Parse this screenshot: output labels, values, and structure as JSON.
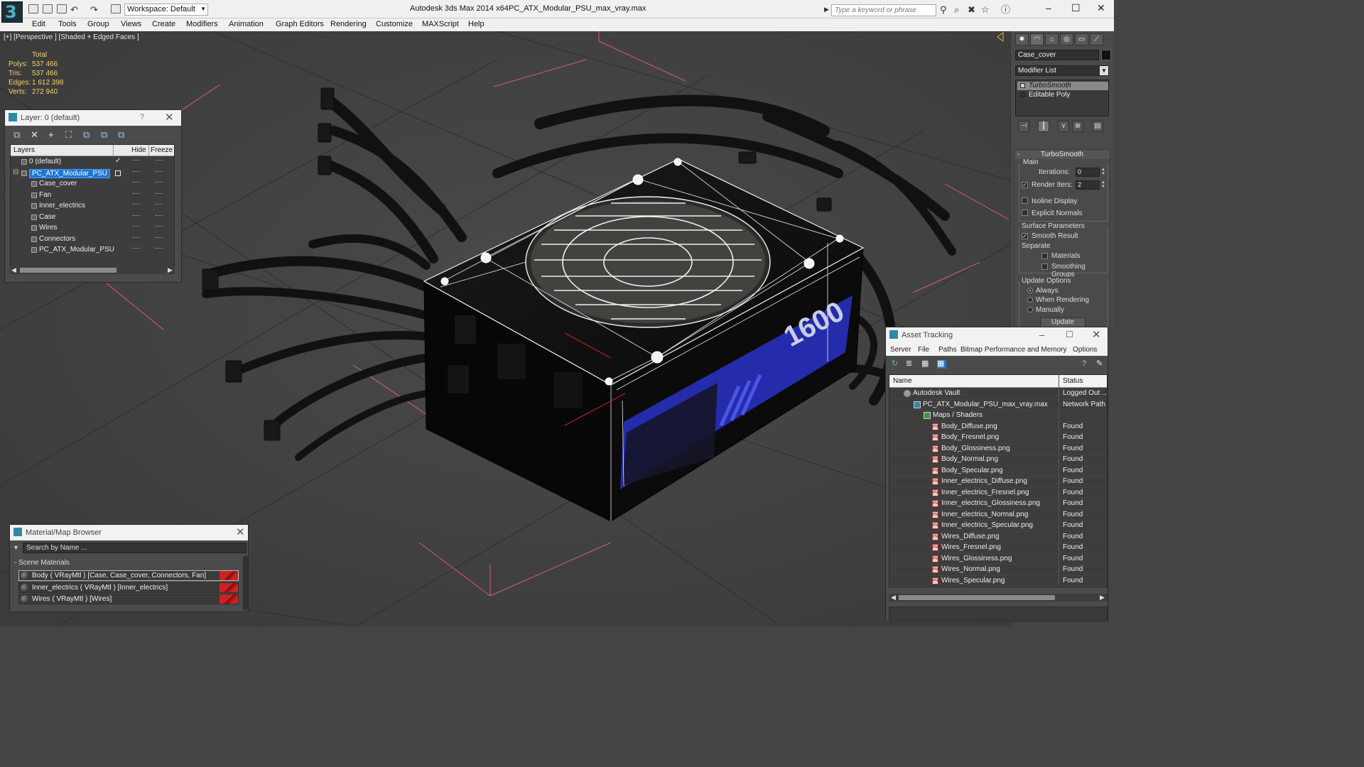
{
  "titlebar": {
    "workspace": "Workspace: Default",
    "app_name": "Autodesk 3ds Max  2014 x64",
    "file_name": "PC_ATX_Modular_PSU_max_vray.max",
    "search_placeholder": "Type a keyword or phrase"
  },
  "menu": [
    "Edit",
    "Tools",
    "Group",
    "Views",
    "Create",
    "Modifiers",
    "Animation",
    "Graph Editors",
    "Rendering",
    "Customize",
    "MAXScript",
    "Help"
  ],
  "viewport": {
    "label": "[+] [Perspective ] [Shaded + Edged Faces ]",
    "stats_header": "Total",
    "stats": [
      {
        "label": "Polys:",
        "value": "537 466"
      },
      {
        "label": "Tris:",
        "value": "537 466"
      },
      {
        "label": "Edges:",
        "value": "1 612 398"
      },
      {
        "label": "Verts:",
        "value": "272 940"
      }
    ],
    "badge_text": "1600"
  },
  "command_panel": {
    "object_name": "Case_cover",
    "modifier_list": "Modifier List",
    "stack": [
      "TurboSmooth",
      "Editable Poly"
    ],
    "turbosmooth": {
      "title": "TurboSmooth",
      "main_label": "Main",
      "iterations_label": "Iterations:",
      "iterations_value": "0",
      "render_iters_label": "Render Iters:",
      "render_iters_value": "2",
      "isoline_label": "Isoline Display",
      "explicit_label": "Explicit Normals",
      "surface_label": "Surface Parameters",
      "smooth_result_label": "Smooth Result",
      "separate_label": "Separate",
      "materials_label": "Materials",
      "smoothing_groups_label": "Smoothing Groups",
      "update_options_label": "Update Options",
      "always_label": "Always",
      "when_rendering_label": "When Rendering",
      "manually_label": "Manually",
      "update_button": "Update"
    }
  },
  "layer_dialog": {
    "title": "Layer: 0 (default)",
    "help": "?",
    "columns": {
      "layers": "Layers",
      "hide": "Hide",
      "freeze": "Freeze"
    },
    "rows": [
      {
        "name": "0 (default)",
        "indent": 0
      },
      {
        "name": "PC_ATX_Modular_PSU",
        "indent": 0
      },
      {
        "name": "Case_cover",
        "indent": 1
      },
      {
        "name": "Fan",
        "indent": 1
      },
      {
        "name": "Inner_electrics",
        "indent": 1
      },
      {
        "name": "Case",
        "indent": 1
      },
      {
        "name": "Wires",
        "indent": 1
      },
      {
        "name": "Connectors",
        "indent": 1
      },
      {
        "name": "PC_ATX_Modular_PSU",
        "indent": 1
      }
    ]
  },
  "material_browser": {
    "title": "Material/Map Browser",
    "search_placeholder": "Search by Name ...",
    "section": "- Scene Materials",
    "materials": [
      "Body  ( VRayMtl )  [Case, Case_cover, Connectors, Fan]",
      "Inner_electrics  ( VRayMtl )  [Inner_electrics]",
      "Wires  ( VRayMtl )  [Wires]"
    ]
  },
  "asset_tracking": {
    "title": "Asset Tracking",
    "menu": [
      "Server",
      "File",
      "Paths",
      "Bitmap Performance and Memory",
      "Options"
    ],
    "columns": {
      "name": "Name",
      "status": "Status"
    },
    "rows": [
      {
        "name": "Autodesk Vault",
        "status": "Logged Out ...",
        "indent": 0,
        "kind": "vault"
      },
      {
        "name": "PC_ATX_Modular_PSU_max_vray.max",
        "status": "Network Path",
        "indent": 1,
        "kind": "max"
      },
      {
        "name": "Maps / Shaders",
        "status": "",
        "indent": 2,
        "kind": "maps"
      },
      {
        "name": "Body_Diffuse.png",
        "status": "Found",
        "indent": 3,
        "kind": "png"
      },
      {
        "name": "Body_Fresnel.png",
        "status": "Found",
        "indent": 3,
        "kind": "png"
      },
      {
        "name": "Body_Glossiness.png",
        "status": "Found",
        "indent": 3,
        "kind": "png"
      },
      {
        "name": "Body_Normal.png",
        "status": "Found",
        "indent": 3,
        "kind": "png"
      },
      {
        "name": "Body_Specular.png",
        "status": "Found",
        "indent": 3,
        "kind": "png"
      },
      {
        "name": "Inner_electrics_Diffuse.png",
        "status": "Found",
        "indent": 3,
        "kind": "png"
      },
      {
        "name": "Inner_electrics_Fresnel.png",
        "status": "Found",
        "indent": 3,
        "kind": "png"
      },
      {
        "name": "Inner_electrics_Glossiness.png",
        "status": "Found",
        "indent": 3,
        "kind": "png"
      },
      {
        "name": "Inner_electrics_Normal.png",
        "status": "Found",
        "indent": 3,
        "kind": "png"
      },
      {
        "name": "Inner_electrics_Specular.png",
        "status": "Found",
        "indent": 3,
        "kind": "png"
      },
      {
        "name": "Wires_Diffuse.png",
        "status": "Found",
        "indent": 3,
        "kind": "png"
      },
      {
        "name": "Wires_Fresnel.png",
        "status": "Found",
        "indent": 3,
        "kind": "png"
      },
      {
        "name": "Wires_Glossiness.png",
        "status": "Found",
        "indent": 3,
        "kind": "png"
      },
      {
        "name": "Wires_Normal.png",
        "status": "Found",
        "indent": 3,
        "kind": "png"
      },
      {
        "name": "Wires_Specular.png",
        "status": "Found",
        "indent": 3,
        "kind": "png"
      }
    ]
  },
  "colors": {
    "stats_text": "#f2d16a",
    "selection_blue": "#1e76d2",
    "badge_blue": "#2a32c8",
    "grid_pink": "#d85a7a"
  }
}
